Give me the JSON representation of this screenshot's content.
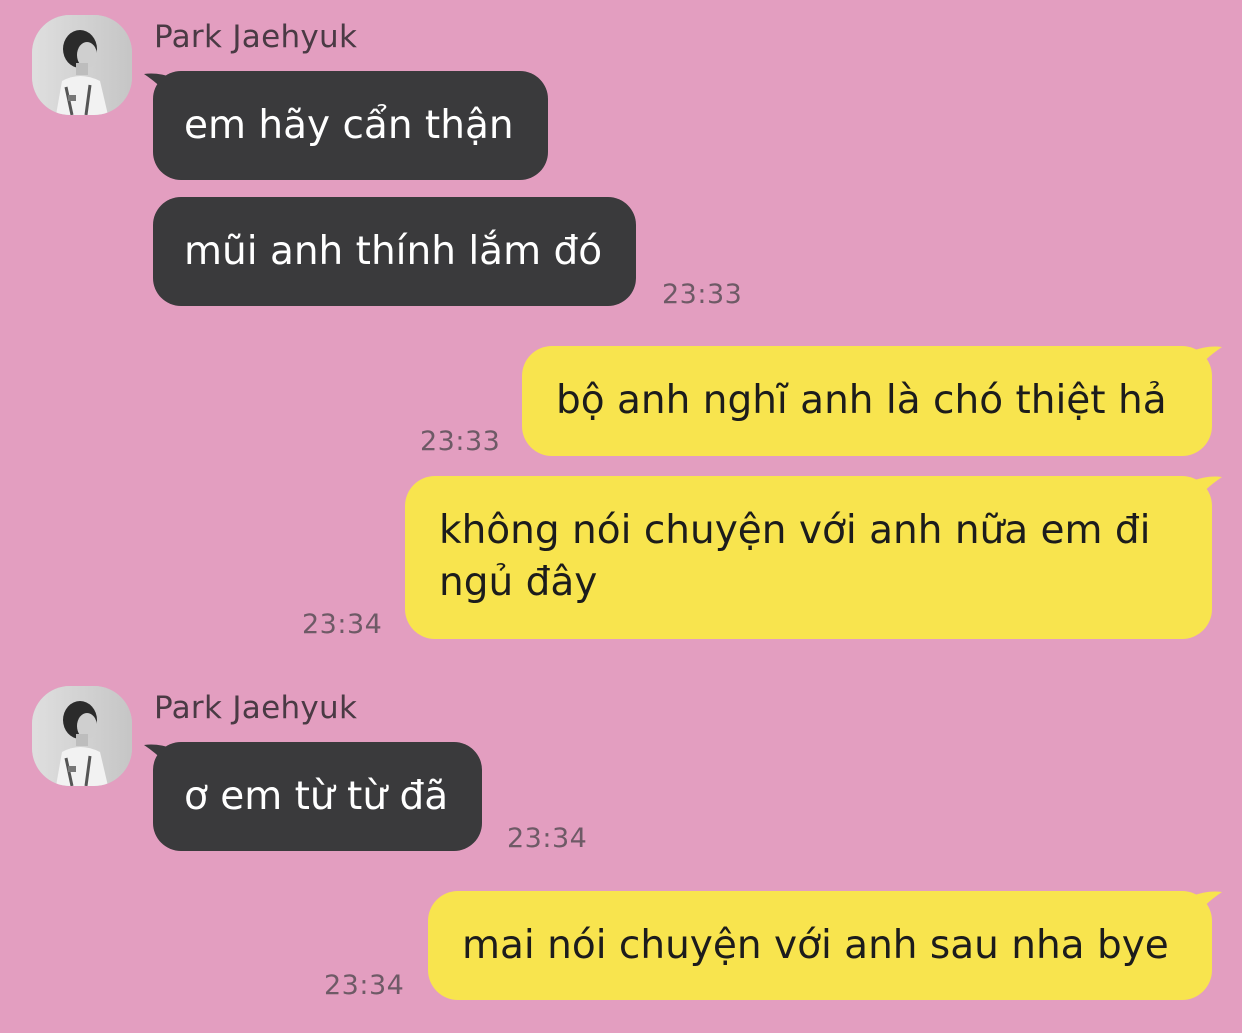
{
  "contact": {
    "name": "Park Jaehyuk",
    "avatar_icon": "profile-photo"
  },
  "colors": {
    "background": "#e39ec0",
    "incoming_bubble": "#3a3a3c",
    "outgoing_bubble": "#f8e44e"
  },
  "messages": [
    {
      "direction": "incoming",
      "sender": "Park Jaehyuk",
      "text": "em hãy cẩn thận"
    },
    {
      "direction": "incoming",
      "text": "mũi anh thính lắm đó",
      "time": "23:33"
    },
    {
      "direction": "outgoing",
      "text": "bộ anh nghĩ anh là chó thiệt hả",
      "time": "23:33"
    },
    {
      "direction": "outgoing",
      "text": "không nói chuyện với anh nữa em đi ngủ đây",
      "time": "23:34"
    },
    {
      "direction": "incoming",
      "sender": "Park Jaehyuk",
      "text": "ơ em từ từ đã",
      "time": "23:34"
    },
    {
      "direction": "outgoing",
      "text": "mai nói chuyện với anh sau nha bye",
      "time": "23:34"
    }
  ]
}
